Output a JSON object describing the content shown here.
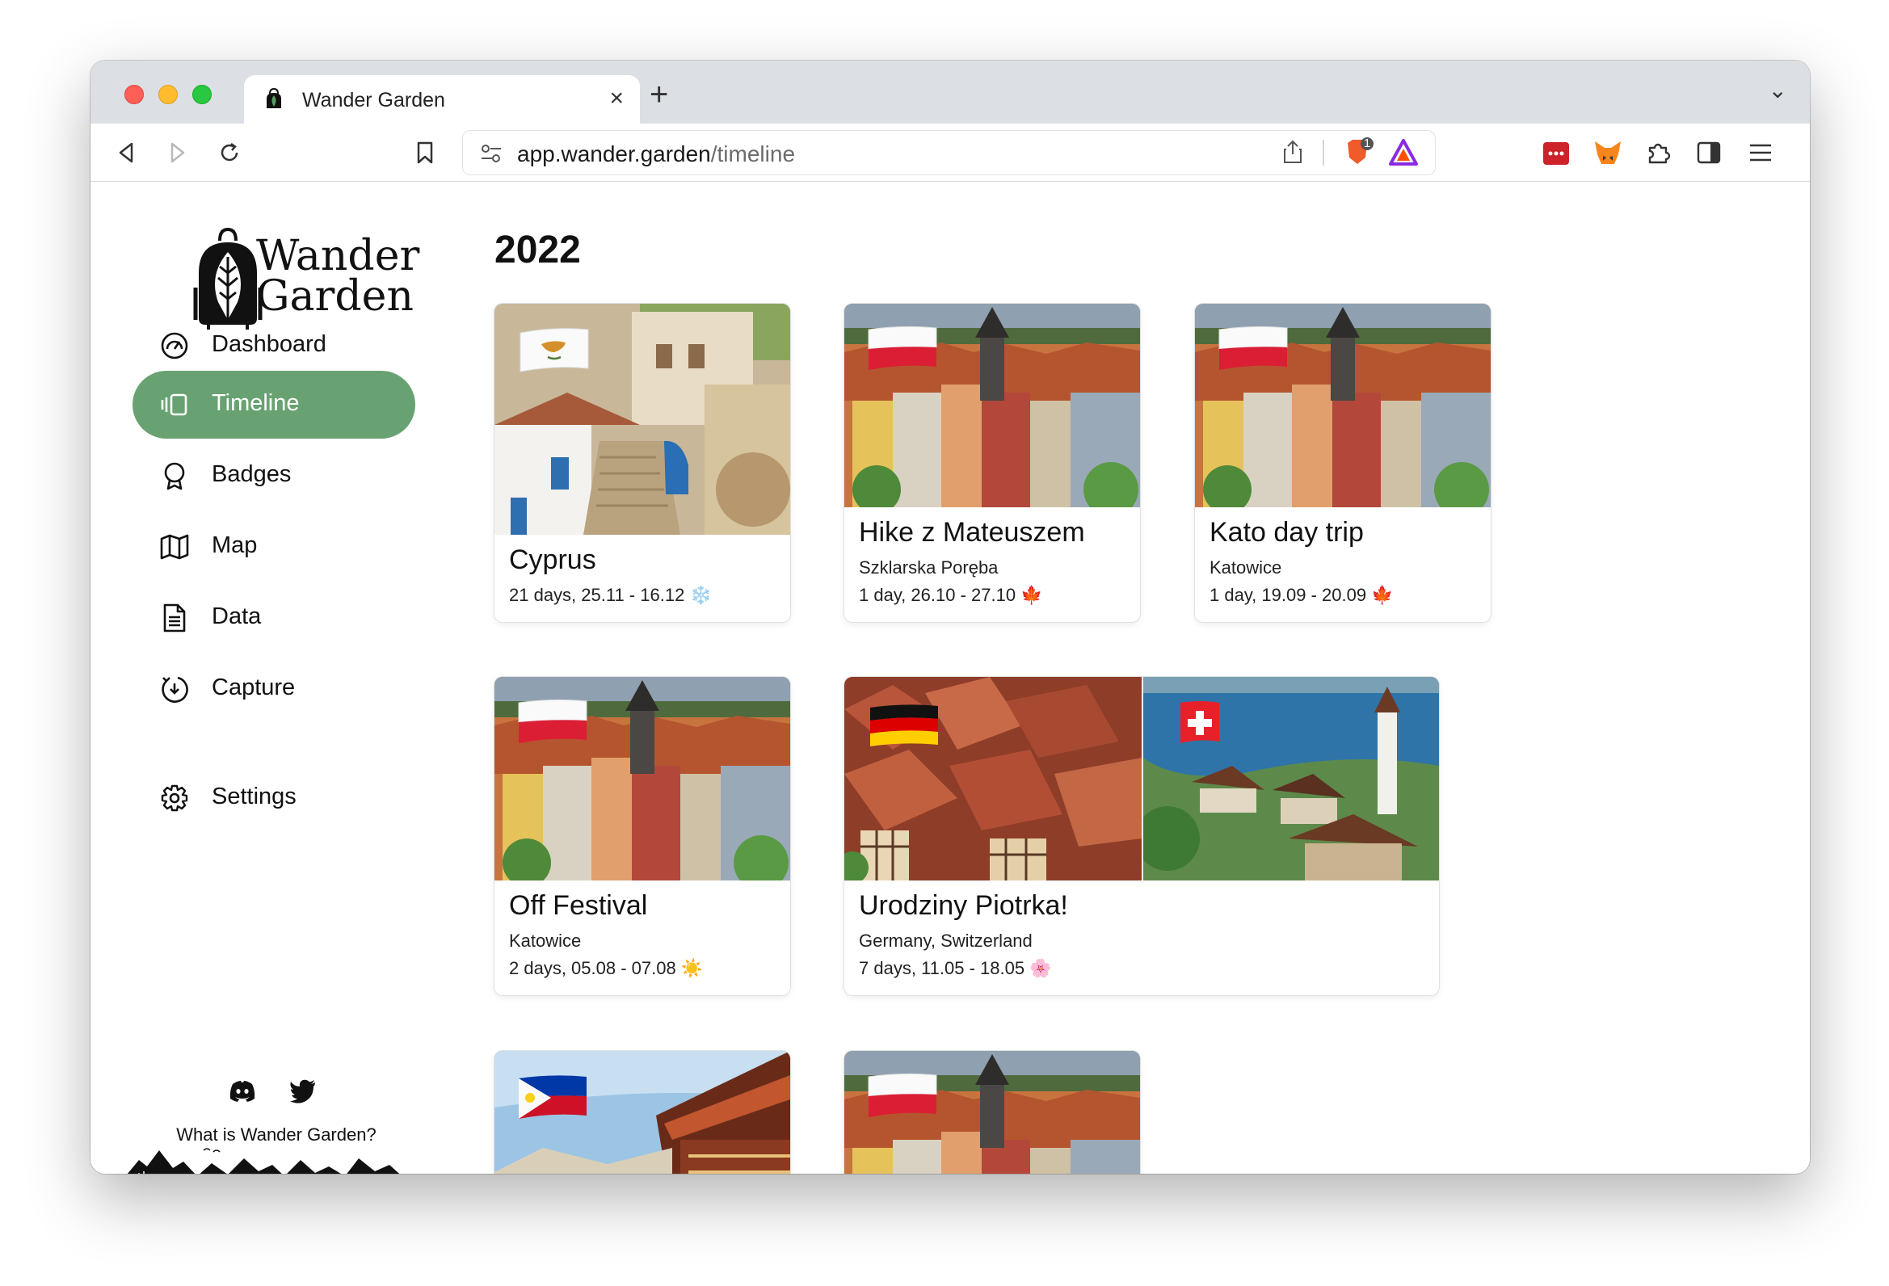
{
  "browser": {
    "tab_title": "Wander Garden",
    "tab_close": "×",
    "new_tab": "+",
    "tab_menu": "⌄",
    "url_host": "app.wander.garden",
    "url_path": "/timeline",
    "shields_badge": "1"
  },
  "sidebar": {
    "logo_line1": "Wander",
    "logo_line2": "Garden",
    "items": [
      {
        "label": "Dashboard",
        "icon": "gauge-icon"
      },
      {
        "label": "Timeline",
        "icon": "timeline-icon",
        "active": true
      },
      {
        "label": "Badges",
        "icon": "badge-icon"
      },
      {
        "label": "Map",
        "icon": "map-icon"
      },
      {
        "label": "Data",
        "icon": "document-icon"
      },
      {
        "label": "Capture",
        "icon": "capture-icon"
      }
    ],
    "settings_label": "Settings",
    "about_label": "What is Wander Garden?"
  },
  "main": {
    "year": "2022",
    "trips": [
      {
        "title": "Cyprus",
        "location": "",
        "dates": "21 days, 25.11 - 16.12",
        "season": "❄️",
        "flags": [
          "cyprus"
        ]
      },
      {
        "title": "Hike z Mateuszem",
        "location": "Szklarska Poręba",
        "dates": "1 day, 26.10 - 27.10",
        "season": "🍁",
        "flags": [
          "poland"
        ]
      },
      {
        "title": "Kato day trip",
        "location": "Katowice",
        "dates": "1 day, 19.09 - 20.09",
        "season": "🍁",
        "flags": [
          "poland"
        ]
      },
      {
        "title": "Off Festival",
        "location": "Katowice",
        "dates": "2 days, 05.08 - 07.08",
        "season": "☀️",
        "flags": [
          "poland"
        ]
      },
      {
        "title": "Urodziny Piotrka!",
        "location": "Germany, Switzerland",
        "dates": "7 days, 11.05 - 18.05",
        "season": "🌸",
        "flags": [
          "germany",
          "switzerland"
        ]
      },
      {
        "title": "",
        "location": "",
        "dates": "",
        "season": "",
        "flags": [
          "philippines"
        ]
      },
      {
        "title": "",
        "location": "",
        "dates": "",
        "season": "",
        "flags": [
          "poland"
        ]
      }
    ]
  },
  "colors": {
    "accent": "#68a272",
    "tabstrip": "#dcdfe4"
  }
}
